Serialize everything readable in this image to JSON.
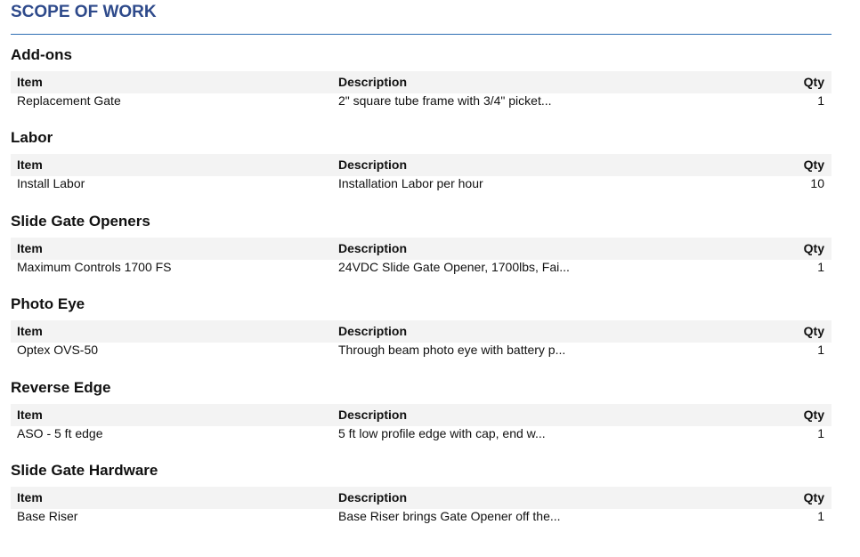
{
  "title": "SCOPE OF WORK",
  "columns": {
    "item": "Item",
    "description": "Description",
    "qty": "Qty"
  },
  "sections": [
    {
      "title": "Add-ons",
      "row": {
        "item": "Replacement Gate",
        "description": "2\" square tube frame with 3/4\" picket...",
        "qty": "1"
      }
    },
    {
      "title": "Labor",
      "row": {
        "item": "Install Labor",
        "description": "Installation Labor per hour",
        "qty": "10"
      }
    },
    {
      "title": "Slide Gate Openers",
      "row": {
        "item": "Maximum Controls 1700 FS",
        "description": "24VDC Slide Gate Opener, 1700lbs, Fai...",
        "qty": "1"
      }
    },
    {
      "title": "Photo Eye",
      "row": {
        "item": "Optex OVS-50",
        "description": "Through beam photo eye with battery p...",
        "qty": "1"
      }
    },
    {
      "title": "Reverse Edge",
      "row": {
        "item": "ASO - 5 ft edge",
        "description": "5 ft low profile edge with cap, end w...",
        "qty": "1"
      }
    },
    {
      "title": "Slide Gate Hardware",
      "row": {
        "item": "Base Riser",
        "description": "Base Riser brings Gate Opener off the...",
        "qty": "1"
      }
    }
  ]
}
